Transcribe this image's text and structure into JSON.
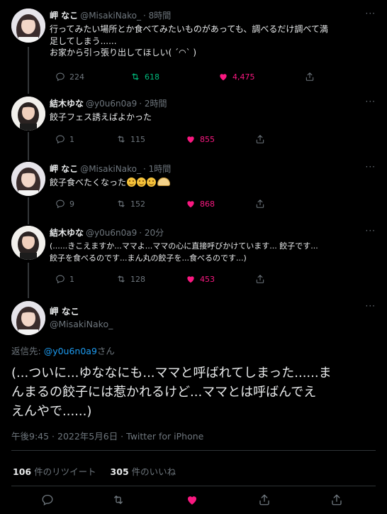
{
  "tweets": [
    {
      "name": "岬 なこ",
      "handle": "@MisakiNako_",
      "time": "8時間",
      "lines": [
        "行ってみたい場所とか食べてみたいものがあっても、調べるだけ調べて満",
        "足してしまう......",
        "お家から引っ張り出してほしい( ´◠` )"
      ],
      "replies": "224",
      "retweets": "618",
      "likes": "4,475"
    },
    {
      "name": "結木ゆな",
      "handle": "@y0u6n0a9",
      "time": "2時間",
      "lines": [
        "餃子フェス誘えばよかった"
      ],
      "replies": "1",
      "retweets": "115",
      "likes": "855"
    },
    {
      "name": "岬 なこ",
      "handle": "@MisakiNako_",
      "time": "1時間",
      "lines": [
        "餃子食べたくなった"
      ],
      "replies": "9",
      "retweets": "152",
      "likes": "868"
    },
    {
      "name": "結木ゆな",
      "handle": "@y0u6n0a9",
      "time": "20分",
      "lines": [
        "(......きこえますか...ママよ...ママの心に直接呼びかけています... 餃子です...",
        "餃子を食べるのです...まん丸の餃子を...食べるのです...)"
      ],
      "replies": "1",
      "retweets": "128",
      "likes": "453"
    }
  ],
  "main": {
    "name": "岬 なこ",
    "handle": "@MisakiNako_",
    "reply_prefix": "返信先: ",
    "reply_to": "@y0u6n0a9",
    "reply_suffix": "さん",
    "text_lines": [
      "(...ついに...ゆななにも...ママと呼ばれてしまった......ま",
      "んまるの餃子には惹かれるけど...ママとは呼ばんでえ",
      "えんやで......)"
    ],
    "timestamp": "午後9:45 · 2022年5月6日 · Twitter for iPhone",
    "retweet_count": "106",
    "retweet_label": " 件のリツイート",
    "like_count": "305",
    "like_label": " 件のいいね"
  },
  "more_label": "···",
  "colors": {
    "like": "#f91880",
    "retweet_active": "#00ba7c",
    "link": "#1d9bf0",
    "muted": "#6e767d"
  }
}
